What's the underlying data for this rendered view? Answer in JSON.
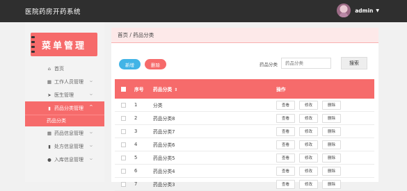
{
  "app": {
    "title": "医院药房开药系统"
  },
  "user": {
    "name": "admin"
  },
  "sidebar": {
    "logo_text": "菜单管理",
    "items": [
      {
        "label": "首页",
        "icon": "home-icon",
        "glyph": "⌂",
        "has_arrow": false
      },
      {
        "label": "工作人员管理",
        "icon": "grid-icon",
        "glyph": "▦",
        "has_arrow": true
      },
      {
        "label": "医生管理",
        "icon": "send-icon",
        "glyph": "➤",
        "has_arrow": true
      },
      {
        "label": "药品分类管理",
        "icon": "folder-icon",
        "glyph": "▮",
        "has_arrow": true,
        "active": true
      },
      {
        "label": "药品信息管理",
        "icon": "grid-icon",
        "glyph": "▦",
        "has_arrow": true
      },
      {
        "label": "处方信息管理",
        "icon": "briefcase-icon",
        "glyph": "▮",
        "has_arrow": true
      },
      {
        "label": "入库信息管理",
        "icon": "user-icon",
        "glyph": "●",
        "has_arrow": true
      }
    ],
    "active_sub": "药品分类"
  },
  "breadcrumb": "首页 / 药品分类",
  "toolbar": {
    "add_label": "新增",
    "delete_label": "删除",
    "search_label": "药品分类",
    "search_placeholder": "药品分类",
    "search_button": "搜索"
  },
  "table": {
    "headers": {
      "no": "序号",
      "name": "药品分类",
      "sort": "⇕",
      "ops": "操作"
    },
    "op_labels": [
      "查看",
      "修改",
      "删除"
    ],
    "rows": [
      {
        "no": "1",
        "name": "分类"
      },
      {
        "no": "2",
        "name": "药品分类8"
      },
      {
        "no": "3",
        "name": "药品分类7"
      },
      {
        "no": "4",
        "name": "药品分类6"
      },
      {
        "no": "5",
        "name": "药品分类5"
      },
      {
        "no": "6",
        "name": "药品分类4"
      },
      {
        "no": "7",
        "name": "药品分类3"
      }
    ]
  },
  "colors": {
    "accent": "#f66b6b",
    "blue": "#42b4e6",
    "topbar": "#2f2f2f"
  }
}
